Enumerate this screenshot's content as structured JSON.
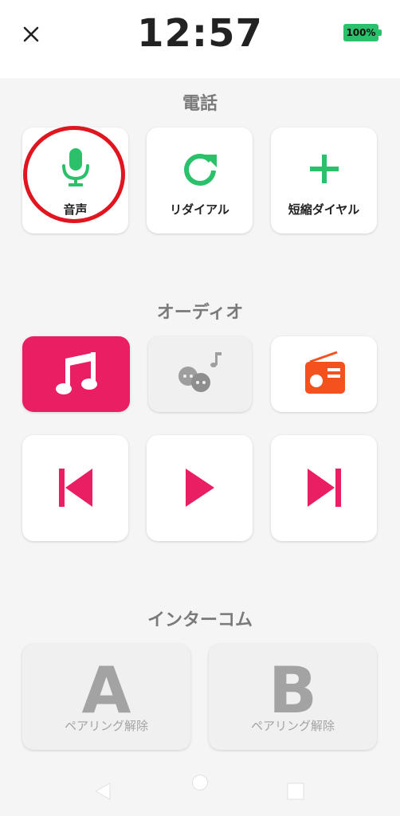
{
  "status": {
    "time": "12:57",
    "battery": "100%"
  },
  "phone": {
    "title": "電話",
    "voice_label": "音声",
    "redial_label": "リダイアル",
    "speed_dial_label": "短縮ダイヤル"
  },
  "audio": {
    "title": "オーディオ"
  },
  "intercom": {
    "title": "インターコム",
    "a_letter": "A",
    "a_sub": "ペアリング解除",
    "b_letter": "B",
    "b_sub": "ペアリング解除"
  },
  "colors": {
    "green": "#2bc06a",
    "pink": "#e91e63",
    "radio_orange": "#f4511e",
    "highlight_red": "#e0151f"
  }
}
